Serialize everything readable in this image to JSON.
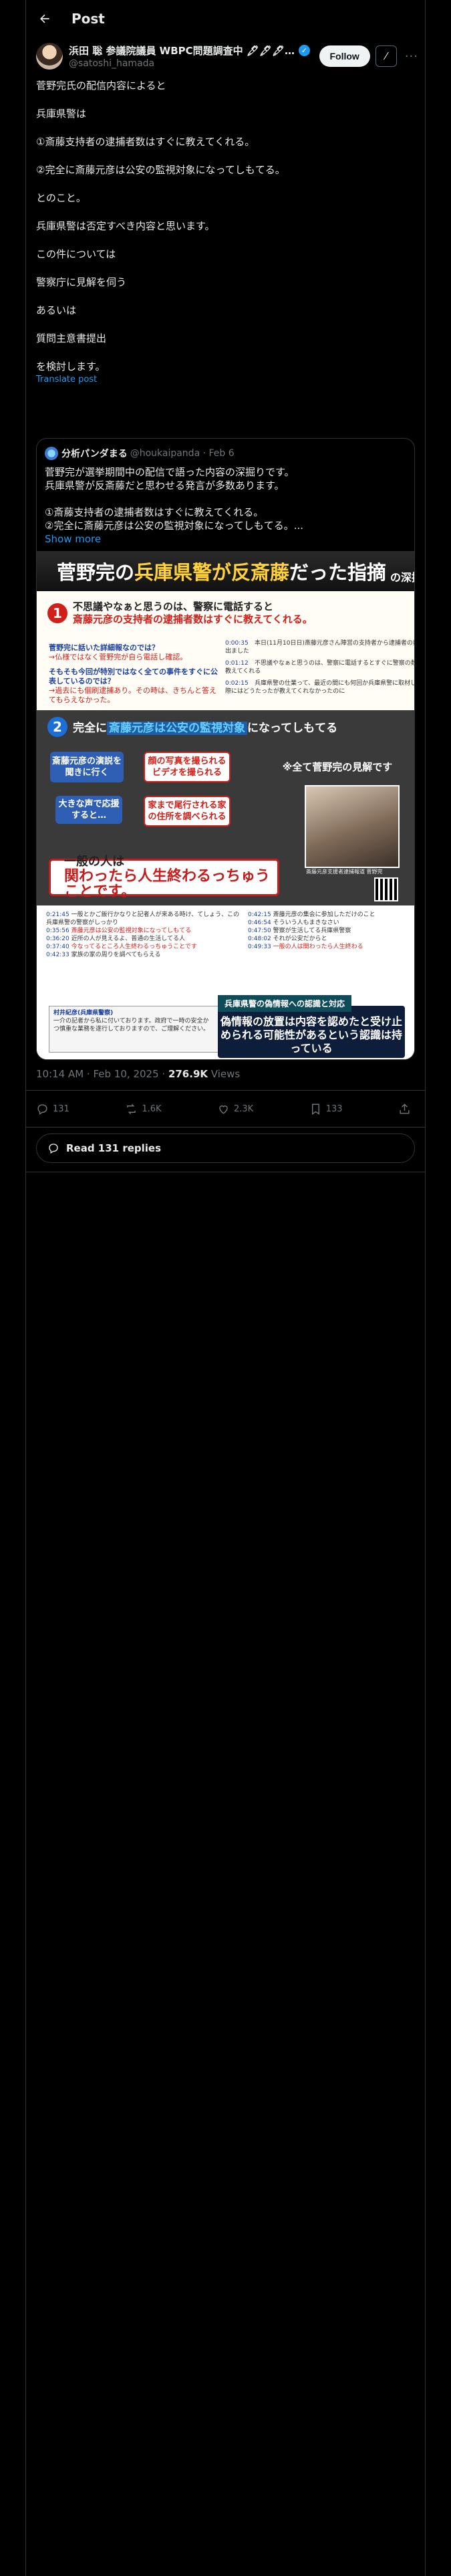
{
  "header": {
    "title": "Post"
  },
  "author": {
    "name": "浜田 聡 参議院議員 WBPC問題調査中 🖋🖋🖋 Y...",
    "handle": "@satoshi_hamada",
    "follow_label": "Follow"
  },
  "post": {
    "lines": [
      "菅野完氏の配信内容によると",
      "兵庫県警は",
      "①斎藤支持者の逮捕者数はすぐに教えてくれる。",
      "②完全に斎藤元彦は公安の監視対象になってしもてる。",
      "とのこと。",
      "兵庫県警は否定すべき内容と思います。",
      "この件については",
      "警察庁に見解を伺う",
      "あるいは",
      "質問主意書提出",
      "を検討します。"
    ],
    "translate": "Translate post"
  },
  "quote": {
    "name": "分析パンダまる",
    "handle": "@houkaipanda · Feb 6",
    "lines": [
      "菅野完が選挙期間中の配信で語った内容の深掘りです。",
      "兵庫県警が反斎藤だと思わせる発言が多数あります。",
      "",
      "①斎藤支持者の逮捕者数はすぐに教えてくれる。",
      "②完全に斎藤元彦は公安の監視対象になってしもてる。..."
    ],
    "show_more": "Show more",
    "image": {
      "title_a": "菅野完の",
      "title_b": "兵庫県警が反斎藤",
      "title_c": "だった指摘",
      "title_d": "の深掘り",
      "sec1_num": "1",
      "sec1_line1": "不思議やなぁと思うのは、警察に電話すると",
      "sec1_line2": "斎藤元彦の支持者の逮捕者数はすぐに教えてくれる。",
      "qa1_q": "菅野完に話いた詳細報なのでは？",
      "qa1_a": "→仏様ではなく菅野完が自ら電話し確認。",
      "qa2_q": "そもそも今回が特別ではなく全ての事件をすぐに公表しているのでは？",
      "qa2_a": "→過去にも個刷逮捕あり。その時は、きちんと答えてもらえなかった。",
      "tl": [
        [
          "0:00:35",
          "本日(11月10日日)斎藤元彦さん陣営の支持者から逮捕者の数は出ました"
        ],
        [
          "0:01:12",
          "不思議やなぁと思うのは、警察に電話するとすぐに警察の数を教えてくれる"
        ],
        [
          "0:02:15",
          "兵庫県警の仕業って、最近の間にも何回か兵庫県警に取材した際にはどうたったが教えてくれなかったのに"
        ]
      ],
      "sec2_num": "2",
      "sec2_head_a": "完全に",
      "sec2_head_b": "斎藤元彦は公安の監視対象",
      "sec2_head_c": "になってしもてる",
      "box_a": "斎藤元彦の演説を聞きに行く",
      "box_b": "顔の写真を撮られるビデオを撮られる",
      "box_c": "大きな声で応援すると…",
      "box_d": "家まで尾行される家の住所を調べられる",
      "box_note": "※全て菅野完の見解です",
      "banner_a": "一般の人は",
      "banner_b": "関わったら人生終わるっちゅうことです。",
      "photo_cap": "斎藤元彦支援者逮捕報道 菅野完",
      "col_left": [
        [
          "0:21:45",
          "一般とかご飯行かなりと記者人が来ある時け、てしょう、この兵庫県警の警察がしっかり"
        ],
        [
          "0:35:56",
          "斎藤元彦は公安の監視対象になってしもてる"
        ],
        [
          "0:36:20",
          "近所の人が見えるよ、普通の生活してる人"
        ],
        [
          "0:37:40",
          "今なってるところ人生終わるっちゅうことです"
        ],
        [
          "0:42:33",
          "家族の家の周りを調べてもらえる"
        ]
      ],
      "col_right": [
        [
          "0:42:15",
          "斎藤元彦の集会に参加しただけのこと"
        ],
        [
          "0:46:54",
          "そういう人もまきなさい"
        ],
        [
          "0:47:50",
          "警察が生活してる兵庫県警察"
        ],
        [
          "0:48:02",
          "それが公安だからと"
        ],
        [
          "0:49:33",
          "一般の人は関わったら人生終わる"
        ]
      ],
      "note_head": "村井紀彦(兵庫県警察)",
      "note_body": "一介の記者から私に付いております。政府で一時の安全かつ慎重な業務を遂行しておりますので、ご理解ください。",
      "bb_tag": "兵庫県警の偽情報への認識と対応",
      "bb_text": "偽情報の放置は内容を認めたと受け止められる可能性があるという認識は持っている"
    }
  },
  "meta": {
    "time": "10:14 AM · Feb 10, 2025 · ",
    "views_count": "276.9K",
    "views_label": " Views"
  },
  "actions": {
    "replies": "131",
    "reposts": "1.6K",
    "likes": "2.3K",
    "bookmarks": "133"
  },
  "read_replies": "Read 131 replies",
  "colors": {
    "accent": "#1d9bf0",
    "bg": "#000000",
    "border": "#2f3336",
    "muted": "#71767b"
  }
}
